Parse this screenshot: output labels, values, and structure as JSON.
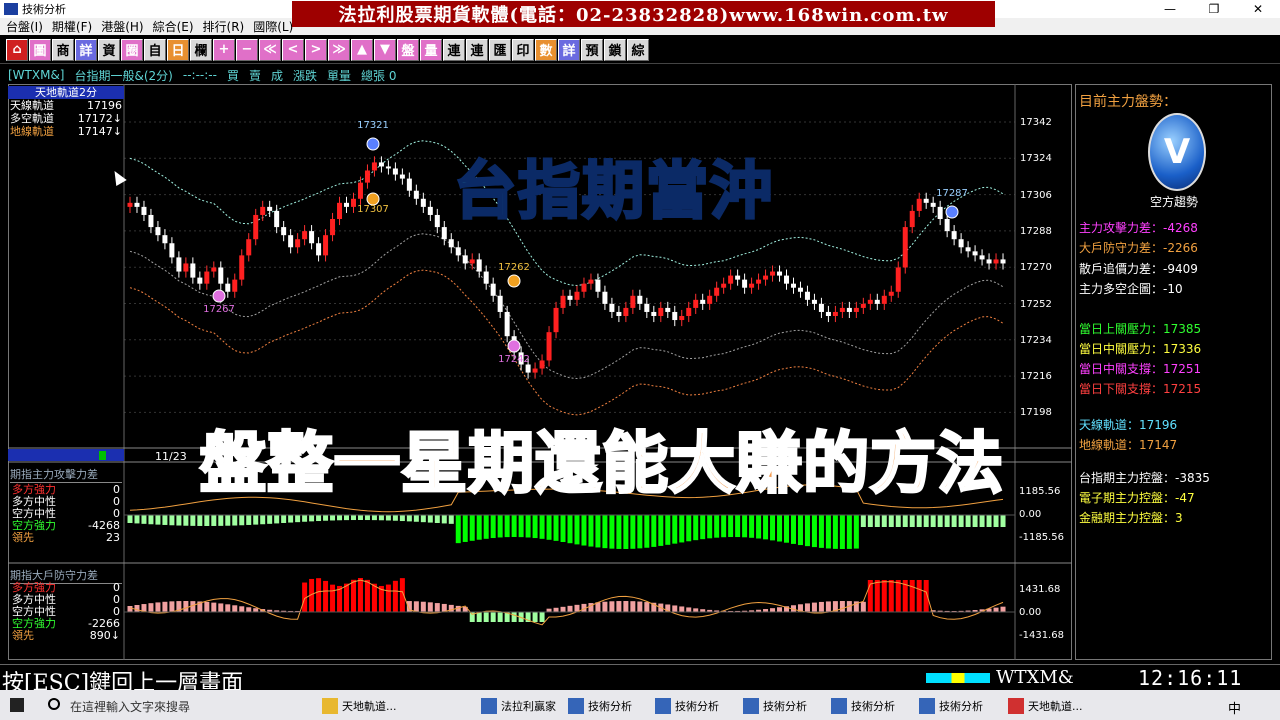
{
  "window": {
    "title": "技術分析",
    "min": "—",
    "max": "❐",
    "close": "✕"
  },
  "menu": [
    "台盤(I)",
    "期權(F)",
    "港盤(H)",
    "綜合(E)",
    "排行(R)",
    "國際(L)"
  ],
  "banner": "法拉利股票期貨軟體(電話：02-23832828)www.168win.com.tw",
  "toolbar": [
    "⌂",
    "圖",
    "商",
    "詳",
    "資",
    "圈",
    "自",
    "日",
    "欄",
    "+",
    "−",
    "≪",
    "<",
    ">",
    "≫",
    "▲",
    "▼",
    "盤",
    "量",
    "連",
    "連",
    "匯",
    "印",
    "數",
    "詳",
    "預",
    "鎖",
    "綜"
  ],
  "infobar": {
    "symbol": "[WTXM&]",
    "name": "台指期一般&(2分)",
    "time": "--:--:--",
    "buy": "買",
    "sell": "賣",
    "deal": "成",
    "change": "漲跌",
    "volume": "單量",
    "total": "總張 0"
  },
  "legend_main": {
    "header": "天地軌道2分",
    "rows": [
      {
        "label": "天線軌道",
        "value": "17196",
        "color": "#ffffff"
      },
      {
        "label": "多空軌道",
        "value": "17172↓",
        "color": "#ffffff"
      },
      {
        "label": "地線軌道",
        "value": "17147↓",
        "color": "#f0a040"
      }
    ]
  },
  "date_label": "11/23",
  "annotations": {
    "a1": "17321",
    "a2": "17307",
    "a3": "17267",
    "a4": "17262",
    "a5": "17242",
    "a6": "17287"
  },
  "sub1": {
    "header": "期指主力攻擊力差",
    "rows": [
      {
        "label": "多方強力",
        "value": "0",
        "color": "#ff3030"
      },
      {
        "label": "多方中性",
        "value": "0",
        "color": "#ffffff"
      },
      {
        "label": "空方中性",
        "value": "0",
        "color": "#ffffff"
      },
      {
        "label": "空方強力",
        "value": "-4268",
        "color": "#30ff30"
      },
      {
        "label": "領先",
        "value": "23",
        "color": "#f0a040"
      }
    ],
    "y": [
      "1185.56",
      "0.00",
      "-1185.56"
    ]
  },
  "sub2": {
    "header": "期指大戶防守力差",
    "rows": [
      {
        "label": "多方強力",
        "value": "0",
        "color": "#ff3030"
      },
      {
        "label": "多方中性",
        "value": "0",
        "color": "#ffffff"
      },
      {
        "label": "空方中性",
        "value": "0",
        "color": "#ffffff"
      },
      {
        "label": "空方強力",
        "value": "-2266",
        "color": "#30ff30"
      },
      {
        "label": "領先",
        "value": "890↓",
        "color": "#f0a040"
      }
    ],
    "y": [
      "1431.68",
      "0.00",
      "-1431.68"
    ]
  },
  "main_y": [
    "17342",
    "17324",
    "17306",
    "17288",
    "17270",
    "17252",
    "17234",
    "17216",
    "17198"
  ],
  "right_panel": {
    "title": "目前主力盤勢：",
    "trend": "空方趨勢",
    "rows": [
      {
        "text": "主力攻擊力差：-4268",
        "color": "#ff40ff"
      },
      {
        "text": "大戶防守力差：-2266",
        "color": "#f0a040"
      },
      {
        "text": "散戶追價力差：-9409",
        "color": "#ffffff"
      },
      {
        "text": "主力多空企圖：-10",
        "color": "#ffffff"
      },
      {
        "text": "當日上關壓力：17385",
        "color": "#30ff30"
      },
      {
        "text": "當日中關壓力：17336",
        "color": "#ffff40"
      },
      {
        "text": "當日中關支撐：17251",
        "color": "#ff40ff"
      },
      {
        "text": "當日下關支撐：17215",
        "color": "#ff4040"
      },
      {
        "text": "天線軌道：17196",
        "color": "#60e0ff"
      },
      {
        "text": "地線軌道：17147",
        "color": "#f0a040"
      },
      {
        "text": "台指期主力控盤：-3835",
        "color": "#ffffff"
      },
      {
        "text": "電子期主力控盤：-47",
        "color": "#ffff40"
      },
      {
        "text": "金融期主力控盤：3",
        "color": "#ffff40"
      }
    ]
  },
  "overlay": {
    "line1": "台指期當沖",
    "line2": "盤整一星期還能大賺的方法"
  },
  "status": {
    "esc": "按[ESC]鍵回上一層畫面",
    "symbol": "WTXM&",
    "clock": "12:16:11"
  },
  "taskbar": {
    "search": "在這裡輸入文字來搜尋",
    "items": [
      "天地軌道...",
      "法拉利贏家",
      "技術分析",
      "技術分析",
      "技術分析",
      "技術分析",
      "技術分析",
      "天地軌道..."
    ],
    "tray": "中"
  },
  "colors": {
    "up": "#ff2020",
    "down": "#ffffff",
    "bull_bar": "#ff0000",
    "bear_bar": "#00ff00"
  }
}
